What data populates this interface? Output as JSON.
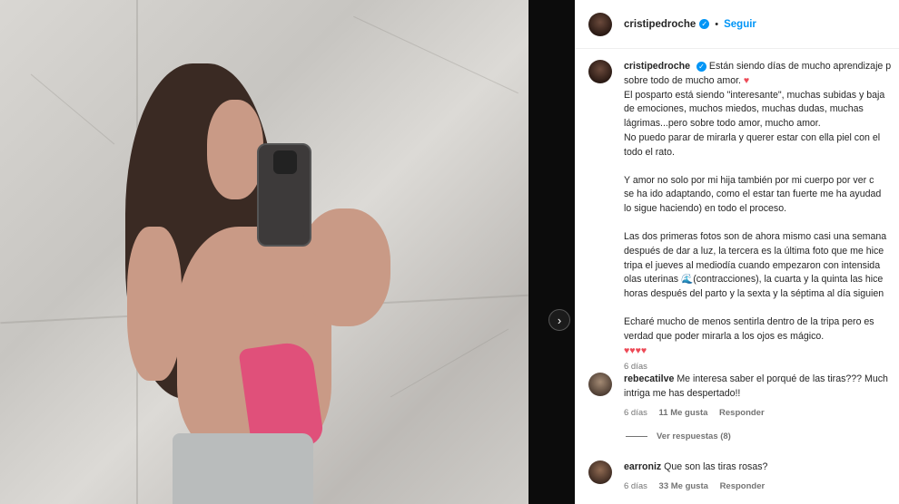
{
  "header": {
    "username": "cristipedroche",
    "verified_icon": "verified-badge-icon",
    "separator": "•",
    "follow_label": "Seguir"
  },
  "caption": {
    "username": "cristipedroche",
    "lines_p1": [
      "Están siendo días de mucho aprendizaje p",
      "sobre todo de mucho amor.",
      "El posparto está siendo \"interesante\", muchas subidas y baja",
      "de emociones, muchos miedos, muchas dudas, muchas",
      "lágrimas...pero sobre todo amor, mucho amor.",
      "No puedo parar de mirarla y querer estar con ella piel con el",
      "todo el rato."
    ],
    "lines_p2": [
      "Y amor no solo por mi hija también por mi cuerpo por ver c",
      "se ha ido adaptando, como el estar tan fuerte me ha ayudad",
      "lo sigue haciendo) en todo el proceso."
    ],
    "lines_p3": [
      "Las dos primeras fotos son de ahora mismo casi una semana",
      "después de dar a luz, la tercera es la última foto que me hice",
      "tripa el jueves al mediodía cuando empezaron con intensida",
      "olas uterinas",
      "(contracciones), la cuarta y la quinta las hice",
      "horas después del parto y la sexta y la séptima al día siguien"
    ],
    "lines_p4": [
      "Echaré mucho de menos sentirla dentro de la tripa pero es",
      "verdad que poder mirarla a los ojos es mágico."
    ],
    "hearts": "♥♥♥♥",
    "time": "6 días"
  },
  "comments": [
    {
      "username": "rebecatilve",
      "text_line1": "Me interesa saber el porqué de las tiras??? Much",
      "text_line2": "intriga me has despertado!!",
      "time": "6 días",
      "likes": "11 Me gusta",
      "reply": "Responder",
      "view_replies": "Ver respuestas (8)"
    },
    {
      "username": "earroniz",
      "text_line1": "Que son las tiras rosas?",
      "time": "6 días",
      "likes": "33 Me gusta",
      "reply": "Responder"
    }
  ],
  "carousel": {
    "next_icon": "chevron-right-icon"
  },
  "colors": {
    "accent": "#0095f6",
    "heart": "#ed4956",
    "muted": "#737373",
    "text": "#262626"
  }
}
